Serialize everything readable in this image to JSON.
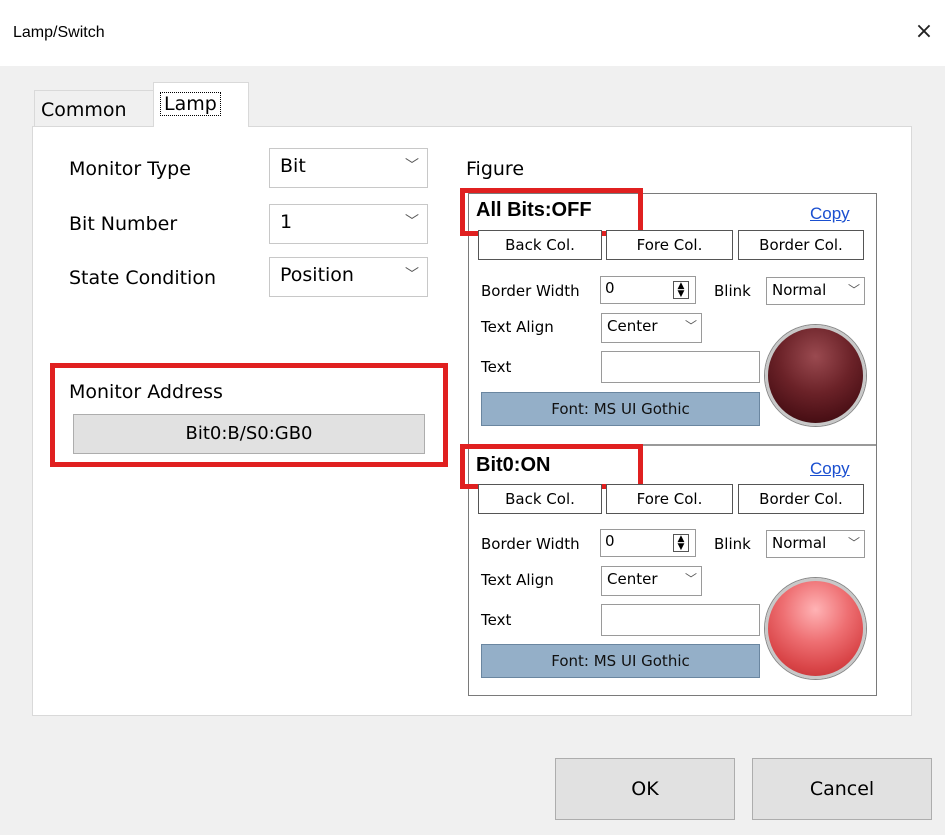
{
  "window": {
    "title": "Lamp/Switch",
    "close_symbol": "×"
  },
  "tabs": [
    {
      "label": "Common"
    },
    {
      "label": "Lamp"
    }
  ],
  "settings": {
    "monitor_type_label": "Monitor Type",
    "monitor_type_value": "Bit",
    "bit_number_label": "Bit Number",
    "bit_number_value": "1",
    "state_condition_label": "State Condition",
    "state_condition_value": "Position",
    "monitor_address_label": "Monitor Address",
    "monitor_address_value": "Bit0:B/S0:GB0"
  },
  "figure": {
    "label": "Figure",
    "states": [
      {
        "title": "All Bits:OFF",
        "copy": "Copy",
        "back_col": "Back Col.",
        "fore_col": "Fore Col.",
        "border_col": "Border Col.",
        "border_width_label": "Border Width",
        "border_width_value": "0",
        "blink_label": "Blink",
        "blink_value": "Normal",
        "text_align_label": "Text Align",
        "text_align_value": "Center",
        "text_label": "Text",
        "text_value": "",
        "font_button": "Font: MS UI Gothic",
        "lamp_state": "off"
      },
      {
        "title": "Bit0:ON",
        "copy": "Copy",
        "back_col": "Back Col.",
        "fore_col": "Fore Col.",
        "border_col": "Border Col.",
        "border_width_label": "Border Width",
        "border_width_value": "0",
        "blink_label": "Blink",
        "blink_value": "Normal",
        "text_align_label": "Text Align",
        "text_align_value": "Center",
        "text_label": "Text",
        "text_value": "",
        "font_button": "Font: MS UI Gothic",
        "lamp_state": "on"
      }
    ]
  },
  "buttons": {
    "ok": "OK",
    "cancel": "Cancel"
  },
  "colors": {
    "highlight_red": "#e02020",
    "lamp_off": "#6b2228",
    "lamp_on": "#ee6f72",
    "font_button_bg": "#94afc8",
    "link": "#1a4fd0"
  },
  "icons": {
    "dropdown": "chevron-down-icon",
    "spinner": "spinner-updown-icon",
    "close": "close-icon"
  }
}
